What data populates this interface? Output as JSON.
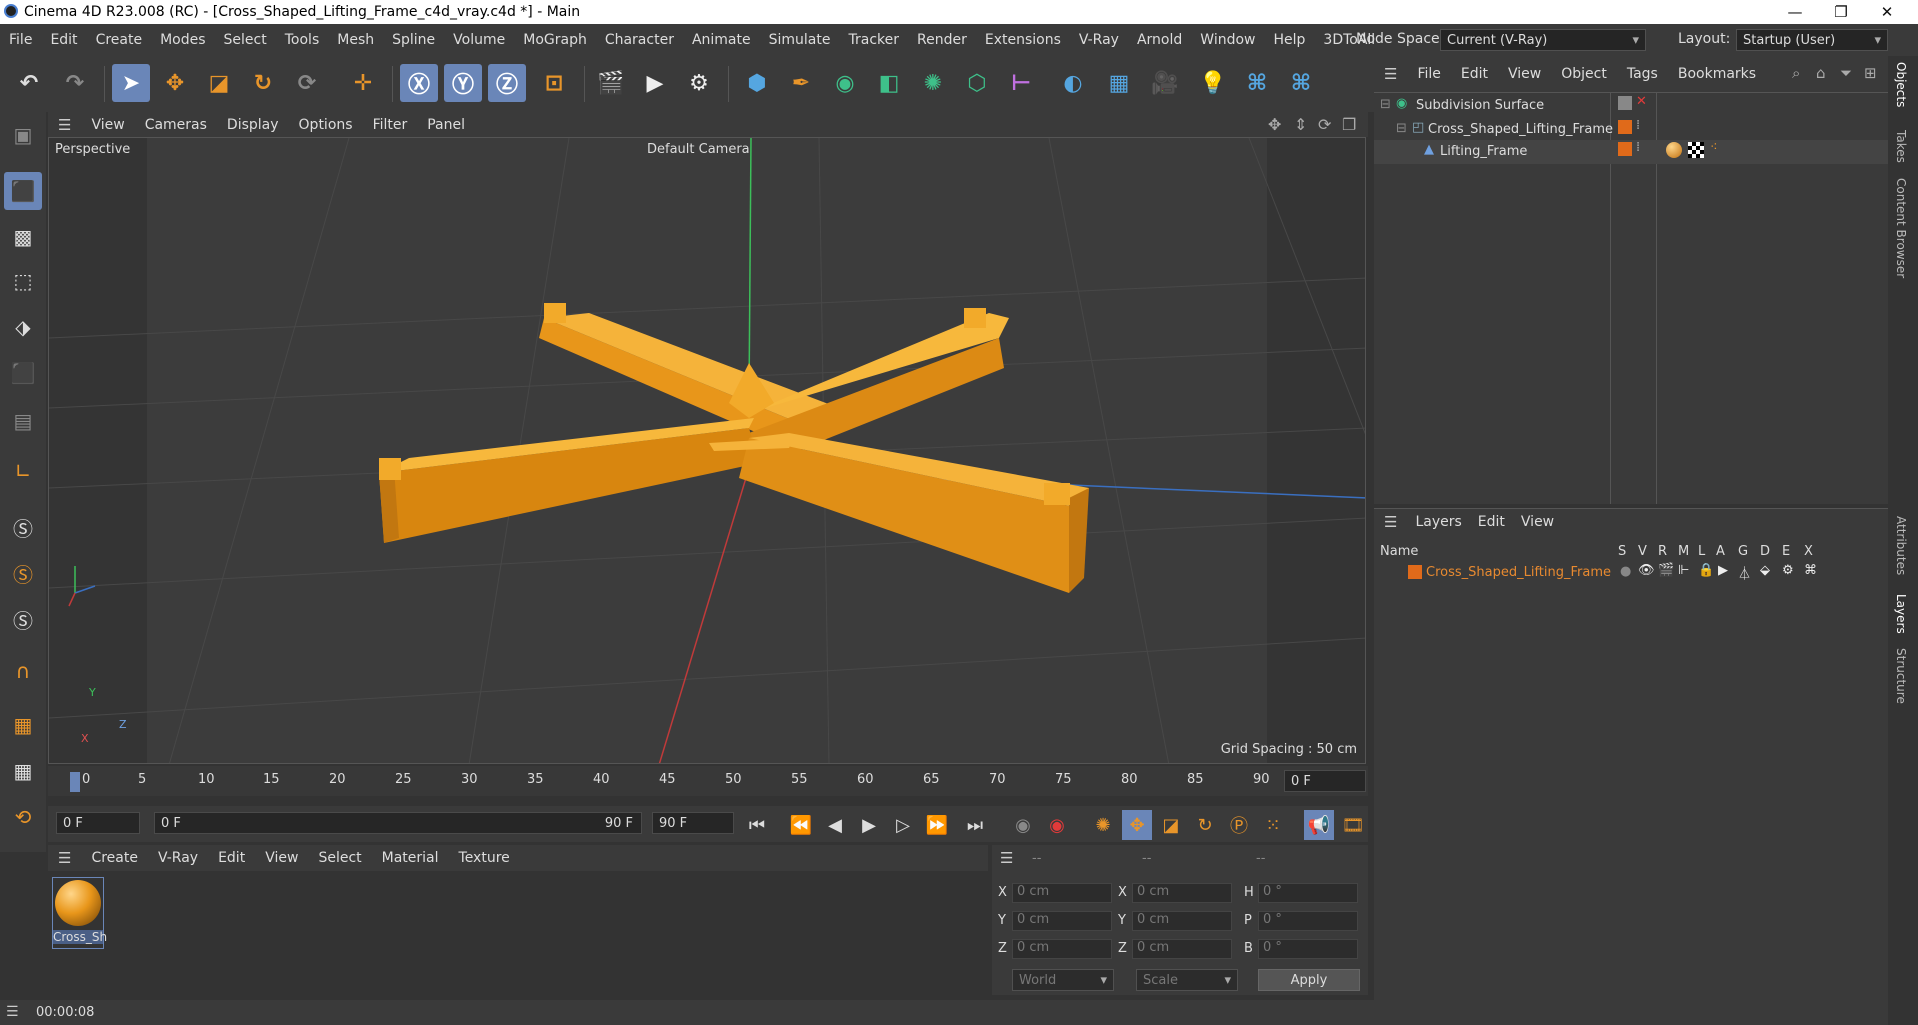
{
  "window": {
    "title": "Cinema 4D R23.008 (RC) - [Cross_Shaped_Lifting_Frame_c4d_vray.c4d *] - Main"
  },
  "menu": [
    "File",
    "Edit",
    "Create",
    "Modes",
    "Select",
    "Tools",
    "Mesh",
    "Spline",
    "Volume",
    "MoGraph",
    "Character",
    "Animate",
    "Simulate",
    "Tracker",
    "Render",
    "Extensions",
    "V-Ray",
    "Arnold",
    "Window",
    "Help",
    "3DToAll"
  ],
  "node_space": {
    "label": "Node Space:",
    "value": "Current (V-Ray)"
  },
  "layout": {
    "label": "Layout:",
    "value": "Startup (User)"
  },
  "viewport_menu": [
    "View",
    "Cameras",
    "Display",
    "Options",
    "Filter",
    "Panel"
  ],
  "viewport": {
    "view_name": "Perspective",
    "camera": "Default Camera",
    "grid_spacing": "Grid Spacing : 50 cm",
    "axis_labels": {
      "y": "Y",
      "z": "Z",
      "x": "X"
    },
    "model_color": "#f0a21f"
  },
  "timeline": {
    "ticks": [
      "0",
      "5",
      "10",
      "15",
      "20",
      "25",
      "30",
      "35",
      "40",
      "45",
      "50",
      "55",
      "60",
      "65",
      "70",
      "75",
      "80",
      "85",
      "90"
    ],
    "current_frame": "0 F"
  },
  "playback": {
    "start": "0 F",
    "range_start": "0 F",
    "range_end": "90 F",
    "end": "90 F"
  },
  "material_menu": [
    "Create",
    "V-Ray",
    "Edit",
    "View",
    "Select",
    "Material",
    "Texture"
  ],
  "material": {
    "name": "Cross_Sh"
  },
  "coords": {
    "headers": [
      "--",
      "--",
      "--"
    ],
    "labels": [
      "X",
      "Y",
      "Z",
      "X",
      "Y",
      "Z",
      "H",
      "P",
      "B"
    ],
    "pos": [
      "0 cm",
      "0 cm",
      "0 cm"
    ],
    "scale": [
      "0 cm",
      "0 cm",
      "0 cm"
    ],
    "rot": [
      "0 °",
      "0 °",
      "0 °"
    ],
    "world": "World",
    "scale_mode": "Scale",
    "apply": "Apply"
  },
  "status": {
    "time": "00:00:08"
  },
  "objects_menu": [
    "File",
    "Edit",
    "View",
    "Object",
    "Tags",
    "Bookmarks"
  ],
  "objects": [
    {
      "name": "Subdivision Surface"
    },
    {
      "name": "Cross_Shaped_Lifting_Frame"
    },
    {
      "name": "Lifting_Frame"
    }
  ],
  "layers_menu": [
    "Layers",
    "Edit",
    "View"
  ],
  "layers": {
    "col_name": "Name",
    "cols": [
      "S",
      "V",
      "R",
      "M",
      "L",
      "A",
      "G",
      "D",
      "E",
      "X"
    ],
    "rows": [
      {
        "name": "Cross_Shaped_Lifting_Frame"
      }
    ]
  },
  "right_tabs": [
    "Objects",
    "Takes",
    "Content Browser",
    "Attributes",
    "Layers",
    "Structure"
  ]
}
